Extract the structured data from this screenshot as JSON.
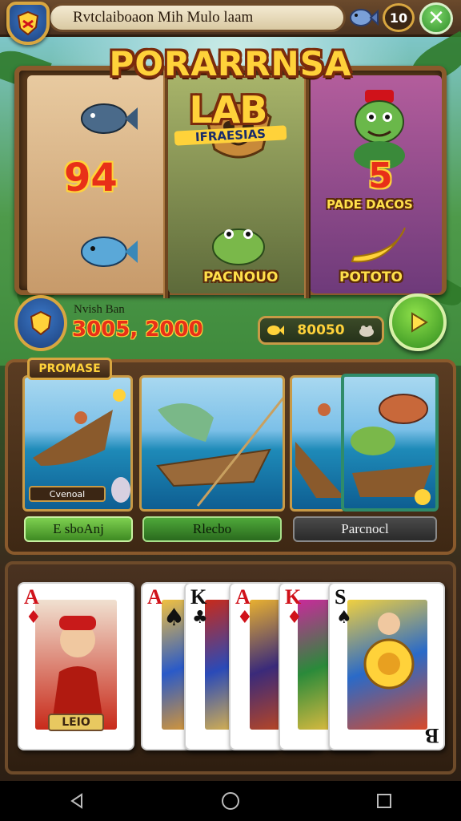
{
  "topbar": {
    "title": "Rvtclaiboaon Mih Mulo laam",
    "coin_count": "10",
    "close_label": "✕"
  },
  "game": {
    "title": "PORARRNSA"
  },
  "reels": {
    "reel1_number": "94",
    "reel2_title": "LAB",
    "reel2_sub": "IFRAESIAS",
    "reel2_caption": "PACNOUO",
    "reel3_number": "5",
    "reel3_label": "PADE DACOS",
    "reel3_caption": "POTOTO"
  },
  "win": {
    "label": "Nvish Ban",
    "amount": "3005, 2000",
    "bet_value": "80050"
  },
  "promotions": {
    "tag": "PROMASE",
    "mini_label": "Cvenoal",
    "buttons": [
      "E sboAnj",
      "Rlecbo",
      "Parcnocl"
    ]
  },
  "cards": {
    "hand": [
      {
        "rank": "A",
        "suit": "♦",
        "color": "red"
      },
      {
        "rank": "A",
        "suit": "♠",
        "color": "black"
      },
      {
        "rank": "K",
        "suit": "♣",
        "color": "black"
      },
      {
        "rank": "A",
        "suit": "♦",
        "color": "red"
      },
      {
        "rank": "K",
        "suit": "♦",
        "color": "red"
      },
      {
        "rank": "S",
        "suit": "♠",
        "color": "black"
      }
    ],
    "first_card_name": "LEIO",
    "last_card_corner": "B"
  },
  "colors": {
    "accent_gold": "#ffd23a",
    "wood": "#6b4a2c",
    "spin_green": "#2f8c1e"
  },
  "icons": [
    "shield-icon",
    "fish-icon",
    "close-icon",
    "play-icon",
    "back-icon",
    "home-icon",
    "recents-icon"
  ]
}
